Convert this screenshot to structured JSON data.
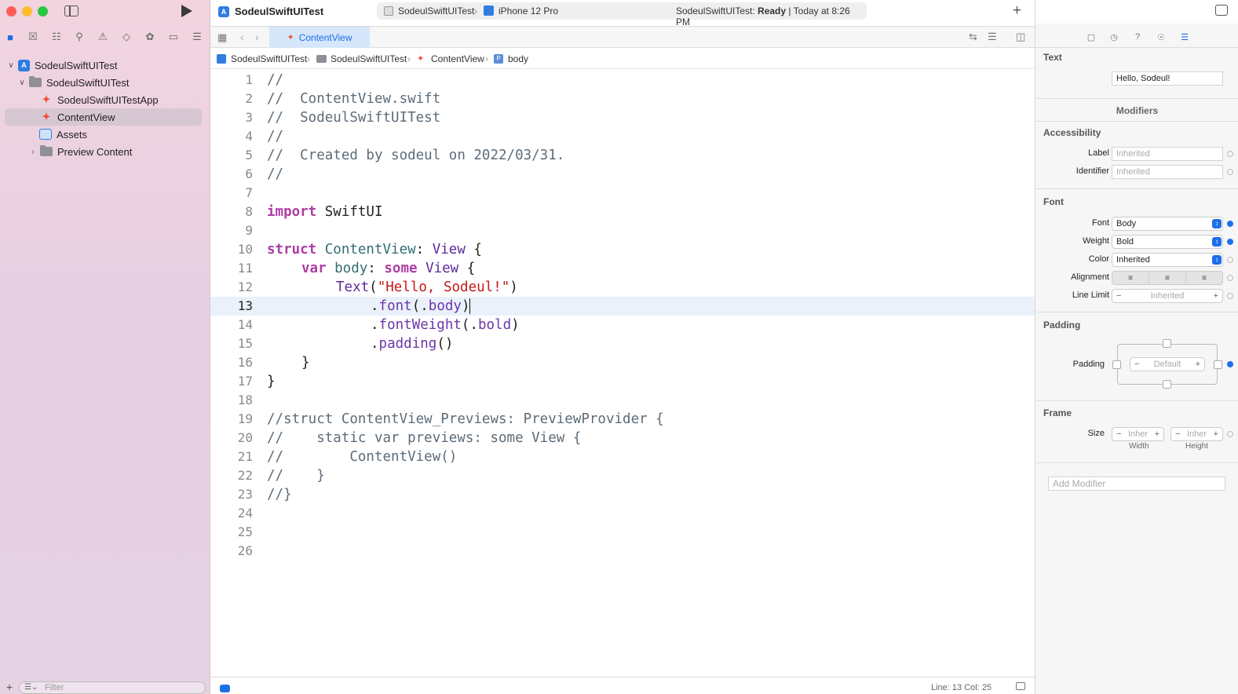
{
  "sidebar": {
    "tree": [
      {
        "label": "SodeulSwiftUITest",
        "kind": "project",
        "expanded": true
      },
      {
        "label": "SodeulSwiftUITest",
        "kind": "folder",
        "expanded": true
      },
      {
        "label": "SodeulSwiftUITestApp",
        "kind": "swift"
      },
      {
        "label": "ContentView",
        "kind": "swift",
        "selected": true
      },
      {
        "label": "Assets",
        "kind": "assets"
      },
      {
        "label": "Preview Content",
        "kind": "folder",
        "expanded": false
      }
    ],
    "filter_placeholder": "Filter"
  },
  "toolbar": {
    "project_title": "SodeulSwiftUITest",
    "scheme_name": "SodeulSwiftUITest",
    "device_name": "iPhone 12 Pro",
    "status_prefix": "SodeulSwiftUITest: ",
    "status_state": "Ready",
    "status_time": "| Today at 8:26 PM",
    "add_label": "+"
  },
  "tab": {
    "label": "ContentView"
  },
  "jumpbar": [
    "SodeulSwiftUITest",
    "SodeulSwiftUITest",
    "ContentView",
    "body"
  ],
  "editor": {
    "current_line": 13,
    "lines": [
      "1",
      "2",
      "3",
      "4",
      "5",
      "6",
      "7",
      "8",
      "9",
      "10",
      "11",
      "12",
      "13",
      "14",
      "15",
      "16",
      "17",
      "18",
      "19",
      "20",
      "21",
      "22",
      "23",
      "24",
      "25",
      "26"
    ],
    "code": {
      "l1": "//",
      "l2": "//  ContentView.swift",
      "l3": "//  SodeulSwiftUITest",
      "l4": "//",
      "l5": "//  Created by sodeul on 2022/03/31.",
      "l6": "//",
      "l8_kw": "import",
      "l8_rest": " SwiftUI",
      "l10_kw": "struct",
      "l10_name": " ContentView",
      "l10_colon": ": ",
      "l10_type": "View",
      "l10_brace": " {",
      "l11_kw": "var",
      "l11_name": " body",
      "l11_colon": ": ",
      "l11_kw2": "some",
      "l11_type": " View",
      "l11_brace": " {",
      "l12_type": "Text",
      "l12_open": "(",
      "l12_str": "\"Hello, Sodeul!\"",
      "l12_close": ")",
      "l13_dot": ".",
      "l13_fn": "font",
      "l13_open": "(.",
      "l13_arg": "body",
      "l13_close": ")",
      "l14_dot": ".",
      "l14_fn": "fontWeight",
      "l14_open": "(.",
      "l14_arg": "bold",
      "l14_close": ")",
      "l15_dot": ".",
      "l15_fn": "padding",
      "l15_close": "()",
      "l16": "}",
      "l17": "}",
      "l19": "//struct ContentView_Previews: PreviewProvider {",
      "l20": "//    static var previews: some View {",
      "l21": "//        ContentView()",
      "l22": "//    }",
      "l23": "//}"
    }
  },
  "statusbar": {
    "position": "Line: 13  Col: 25"
  },
  "inspector": {
    "text_section": "Text",
    "text_value": "Hello, Sodeul!",
    "modifiers_title": "Modifiers",
    "accessibility": {
      "title": "Accessibility",
      "label": "Label",
      "label_value": "Inherited",
      "identifier": "Identifier",
      "identifier_value": "Inherited"
    },
    "font": {
      "title": "Font",
      "font_label": "Font",
      "font_value": "Body",
      "weight_label": "Weight",
      "weight_value": "Bold",
      "color_label": "Color",
      "color_value": "Inherited",
      "alignment_label": "Alignment",
      "line_limit_label": "Line Limit",
      "line_limit_value": "Inherited"
    },
    "padding": {
      "title": "Padding",
      "label": "Padding",
      "value": "Default"
    },
    "frame": {
      "title": "Frame",
      "size_label": "Size",
      "width_value": "Inher",
      "height_value": "Inher",
      "width_label": "Width",
      "height_label": "Height"
    },
    "add_modifier_placeholder": "Add Modifier"
  },
  "colors": {
    "accent": "#1f6fe8",
    "keyword": "#ad3da4",
    "string": "#c41a16",
    "sidebar_bg": "#f2d4df"
  }
}
